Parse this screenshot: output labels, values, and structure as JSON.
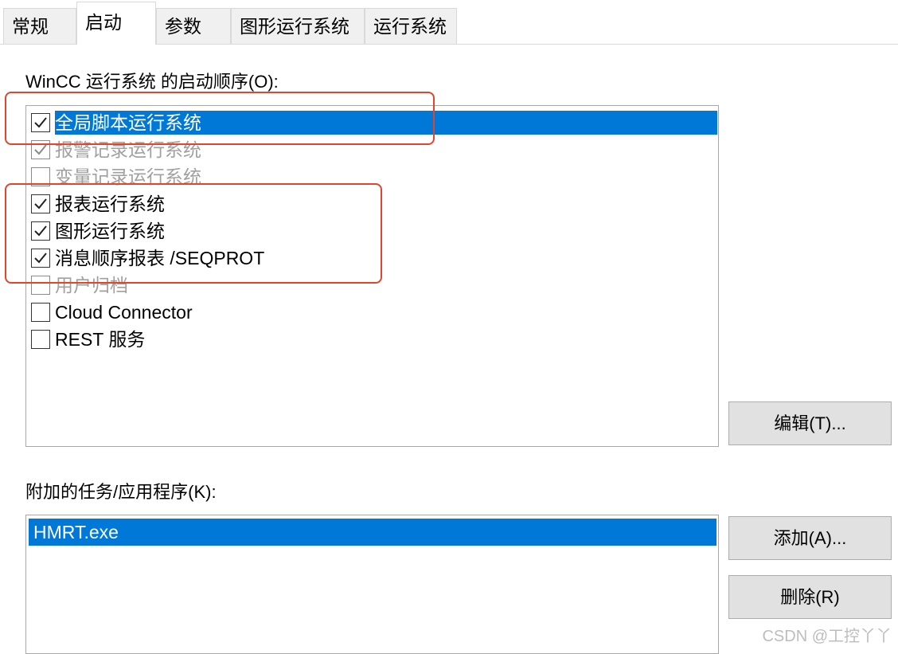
{
  "tabs": [
    {
      "label": "常规",
      "active": false
    },
    {
      "label": "启动",
      "active": true
    },
    {
      "label": "参数",
      "active": false
    },
    {
      "label": "图形运行系统",
      "active": false
    },
    {
      "label": "运行系统",
      "active": false
    }
  ],
  "startup": {
    "label": "WinCC 运行系统 的启动顺序(O):",
    "items": [
      {
        "label": "全局脚本运行系统",
        "checked": true,
        "selected": true,
        "disabled": false
      },
      {
        "label": "报警记录运行系统",
        "checked": true,
        "selected": false,
        "disabled": true
      },
      {
        "label": "变量记录运行系统",
        "checked": false,
        "selected": false,
        "disabled": true
      },
      {
        "label": "报表运行系统",
        "checked": true,
        "selected": false,
        "disabled": false
      },
      {
        "label": "图形运行系统",
        "checked": true,
        "selected": false,
        "disabled": false
      },
      {
        "label": "消息顺序报表 /SEQPROT",
        "checked": true,
        "selected": false,
        "disabled": false
      },
      {
        "label": "用户归档",
        "checked": false,
        "selected": false,
        "disabled": true
      },
      {
        "label": "Cloud Connector",
        "checked": false,
        "selected": false,
        "disabled": false
      },
      {
        "label": "REST 服务",
        "checked": false,
        "selected": false,
        "disabled": false
      }
    ],
    "edit_button": "编辑(T)..."
  },
  "tasks": {
    "label": "附加的任务/应用程序(K):",
    "items": [
      "HMRT.exe"
    ],
    "add_button": "添加(A)...",
    "delete_button": "删除(R)"
  },
  "watermark": "CSDN @工控丫丫",
  "colors": {
    "selection": "#0078d7",
    "highlight_box": "#e2452c"
  }
}
